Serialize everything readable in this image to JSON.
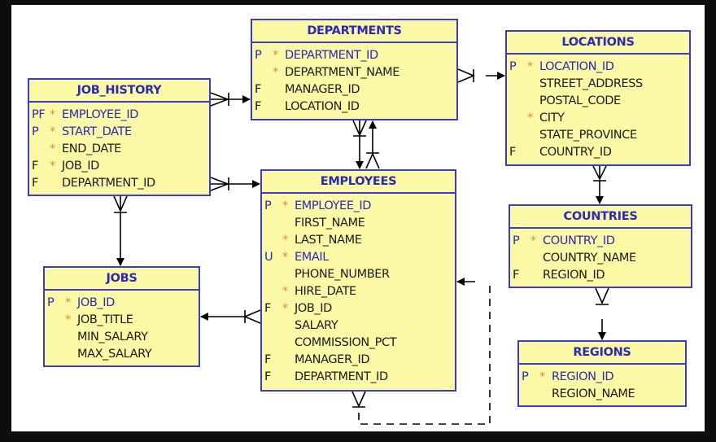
{
  "entities": [
    {
      "id": "departments",
      "name": "DEPARTMENTS",
      "columns": [
        {
          "key": "P",
          "required": true,
          "name": "DEPARTMENT_ID",
          "pk": true
        },
        {
          "key": "",
          "required": true,
          "name": "DEPARTMENT_NAME",
          "pk": false
        },
        {
          "key": "F",
          "required": false,
          "name": "MANAGER_ID",
          "pk": false
        },
        {
          "key": "F",
          "required": false,
          "name": "LOCATION_ID",
          "pk": false
        }
      ]
    },
    {
      "id": "locations",
      "name": "LOCATIONS",
      "columns": [
        {
          "key": "P",
          "required": true,
          "name": "LOCATION_ID",
          "pk": true
        },
        {
          "key": "",
          "required": false,
          "name": "STREET_ADDRESS",
          "pk": false
        },
        {
          "key": "",
          "required": false,
          "name": "POSTAL_CODE",
          "pk": false
        },
        {
          "key": "",
          "required": true,
          "name": "CITY",
          "pk": false
        },
        {
          "key": "",
          "required": false,
          "name": "STATE_PROVINCE",
          "pk": false
        },
        {
          "key": "F",
          "required": false,
          "name": "COUNTRY_ID",
          "pk": false
        }
      ]
    },
    {
      "id": "job_history",
      "name": "JOB_HISTORY",
      "columns": [
        {
          "key": "PF",
          "required": true,
          "name": "EMPLOYEE_ID",
          "pk": true
        },
        {
          "key": "P",
          "required": true,
          "name": "START_DATE",
          "pk": true
        },
        {
          "key": "",
          "required": true,
          "name": "END_DATE",
          "pk": false
        },
        {
          "key": "F",
          "required": true,
          "name": "JOB_ID",
          "pk": false
        },
        {
          "key": "F",
          "required": false,
          "name": "DEPARTMENT_ID",
          "pk": false
        }
      ]
    },
    {
      "id": "employees",
      "name": "EMPLOYEES",
      "columns": [
        {
          "key": "P",
          "required": true,
          "name": "EMPLOYEE_ID",
          "pk": true
        },
        {
          "key": "",
          "required": false,
          "name": "FIRST_NAME",
          "pk": false
        },
        {
          "key": "",
          "required": true,
          "name": "LAST_NAME",
          "pk": false
        },
        {
          "key": "U",
          "required": true,
          "name": "EMAIL",
          "pk": true
        },
        {
          "key": "",
          "required": false,
          "name": "PHONE_NUMBER",
          "pk": false
        },
        {
          "key": "",
          "required": true,
          "name": "HIRE_DATE",
          "pk": false
        },
        {
          "key": "F",
          "required": true,
          "name": "JOB_ID",
          "pk": false
        },
        {
          "key": "",
          "required": false,
          "name": "SALARY",
          "pk": false
        },
        {
          "key": "",
          "required": false,
          "name": "COMMISSION_PCT",
          "pk": false
        },
        {
          "key": "F",
          "required": false,
          "name": "MANAGER_ID",
          "pk": false
        },
        {
          "key": "F",
          "required": false,
          "name": "DEPARTMENT_ID",
          "pk": false
        }
      ]
    },
    {
      "id": "jobs",
      "name": "JOBS",
      "columns": [
        {
          "key": "P",
          "required": true,
          "name": "JOB_ID",
          "pk": true
        },
        {
          "key": "",
          "required": true,
          "name": "JOB_TITLE",
          "pk": false
        },
        {
          "key": "",
          "required": false,
          "name": "MIN_SALARY",
          "pk": false
        },
        {
          "key": "",
          "required": false,
          "name": "MAX_SALARY",
          "pk": false
        }
      ]
    },
    {
      "id": "countries",
      "name": "COUNTRIES",
      "columns": [
        {
          "key": "P",
          "required": true,
          "name": "COUNTRY_ID",
          "pk": true
        },
        {
          "key": "",
          "required": false,
          "name": "COUNTRY_NAME",
          "pk": false
        },
        {
          "key": "F",
          "required": false,
          "name": "REGION_ID",
          "pk": false
        }
      ]
    },
    {
      "id": "regions",
      "name": "REGIONS",
      "columns": [
        {
          "key": "P",
          "required": true,
          "name": "REGION_ID",
          "pk": true
        },
        {
          "key": "",
          "required": false,
          "name": "REGION_NAME",
          "pk": false
        }
      ]
    }
  ],
  "relationships": [
    {
      "from": "JOB_HISTORY",
      "to": "DEPARTMENTS"
    },
    {
      "from": "JOB_HISTORY",
      "to": "EMPLOYEES"
    },
    {
      "from": "JOB_HISTORY",
      "to": "JOBS"
    },
    {
      "from": "DEPARTMENTS",
      "to": "LOCATIONS"
    },
    {
      "from": "DEPARTMENTS",
      "to": "EMPLOYEES"
    },
    {
      "from": "EMPLOYEES",
      "to": "DEPARTMENTS"
    },
    {
      "from": "EMPLOYEES",
      "to": "JOBS"
    },
    {
      "from": "EMPLOYEES",
      "to": "EMPLOYEES",
      "style": "dashed"
    },
    {
      "from": "LOCATIONS",
      "to": "COUNTRIES"
    },
    {
      "from": "COUNTRIES",
      "to": "REGIONS"
    }
  ],
  "colors": {
    "entity_fill": "#fbf8a6",
    "entity_border": "#3b3bc4",
    "title": "#2a2ab4",
    "required_mark": "#e08a4a"
  }
}
